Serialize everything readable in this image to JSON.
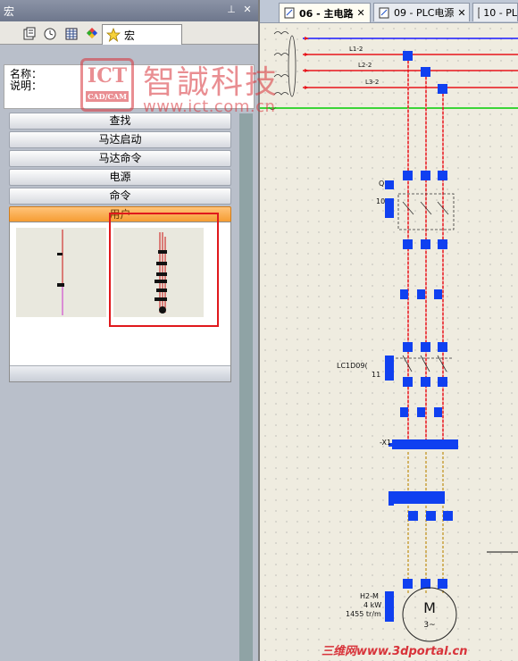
{
  "panel": {
    "title": "宏",
    "pin_glyph": "⊥",
    "close_glyph": "✕",
    "tabs": [
      {
        "icon": "pages-icon"
      },
      {
        "icon": "clock-icon"
      },
      {
        "icon": "grid-icon"
      },
      {
        "icon": "cubes-icon"
      },
      {
        "icon": "star-icon",
        "label": "宏"
      }
    ],
    "props": {
      "name_label": "名称：",
      "desc_label": "说明："
    },
    "sections": [
      "查找",
      "马达启动",
      "马达命令",
      "电源",
      "命令",
      "用户"
    ],
    "active_section": "用户"
  },
  "doc_tabs": [
    {
      "label": "06 - 主电路",
      "active": true
    },
    {
      "label": "09 - PLC电源",
      "active": false
    },
    {
      "label": "10 - PL",
      "active": false
    }
  ],
  "doc_tab_close": "✕",
  "schematic": {
    "wires": [
      "L1-2",
      "L2-2",
      "L3-2"
    ],
    "labels": {
      "q": "Q",
      "q_num": "10",
      "contactor": "LC1D09(",
      "contactor_num": "11",
      "x1": "-X1",
      "motor_kw": "4 kW",
      "motor_rpm": "1455 tr/m",
      "motor_code": "H2-M",
      "motor_symbol": "M",
      "motor_phase": "3~"
    },
    "colors": {
      "wire": "#e8141a",
      "blue_bus": "#1a1aff",
      "green_bus": "#00cc00",
      "terminal": "#1040f0",
      "dashed_wire": "#c8a03c"
    }
  },
  "watermark": {
    "logo_top": "ICT",
    "logo_sub": "CAD/CAM",
    "title": "智誠科技",
    "url": "www.ict.com.cn",
    "bottom": "三维网www.3dportal.cn"
  }
}
